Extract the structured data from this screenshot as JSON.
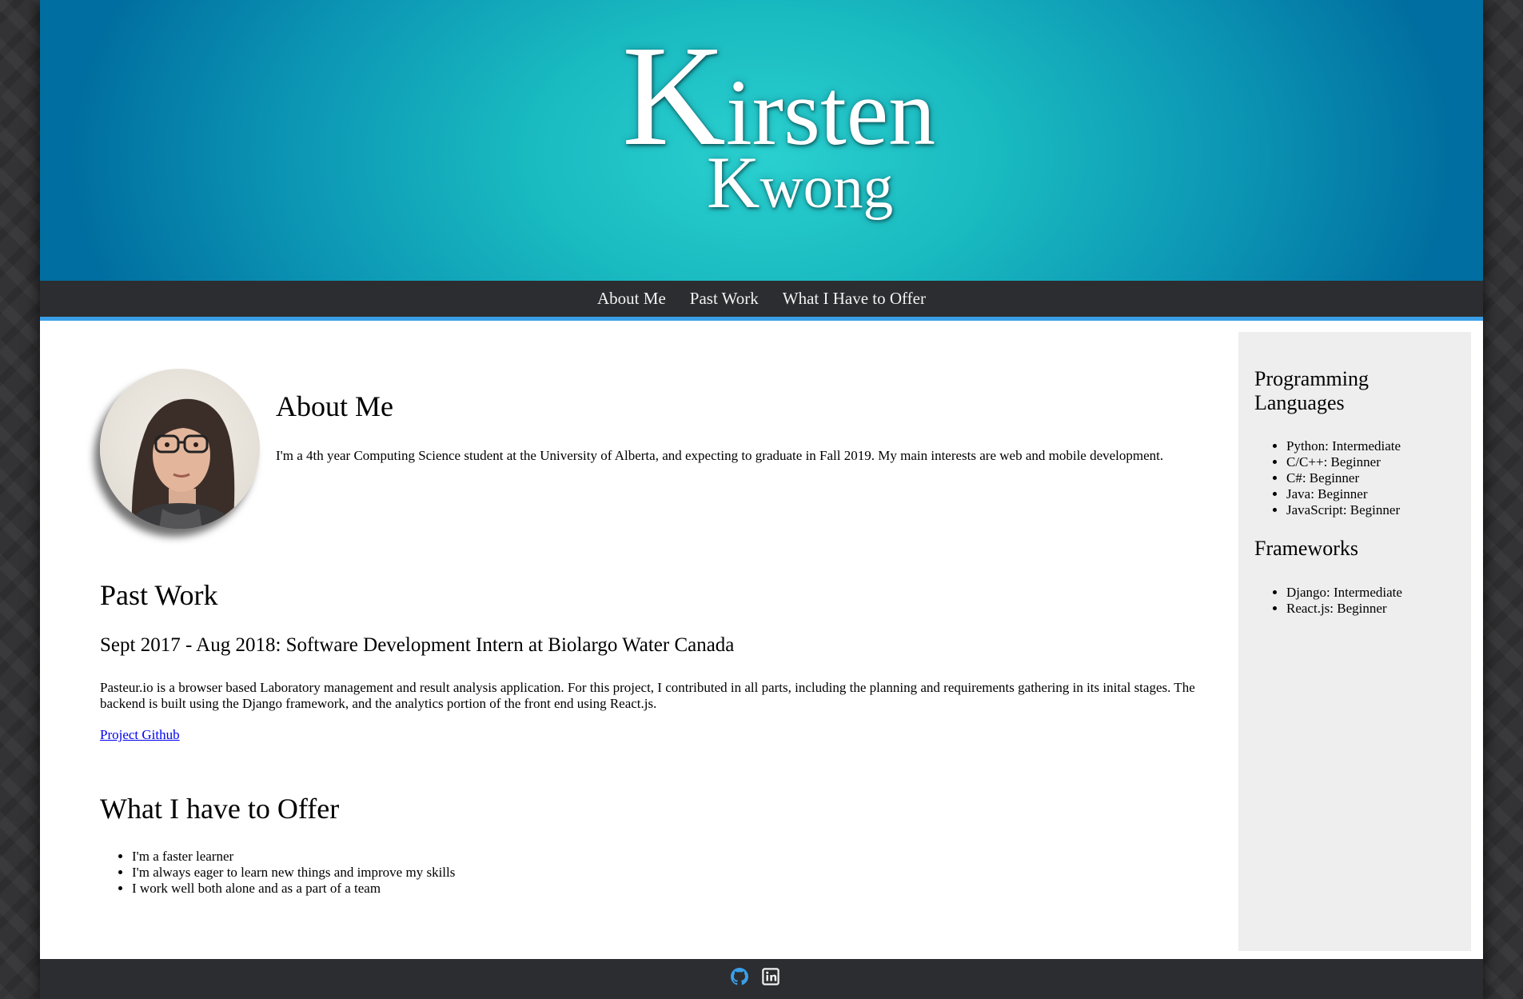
{
  "banner": {
    "first_initial": "K",
    "first_rest": "irsten",
    "last_initial": "K",
    "last_rest": "wong"
  },
  "nav": {
    "items": [
      {
        "label": "About Me"
      },
      {
        "label": "Past Work"
      },
      {
        "label": "What I Have to Offer"
      }
    ]
  },
  "about": {
    "title": "About Me",
    "text": "I'm a 4th year Computing Science student at the University of Alberta, and expecting to graduate in Fall 2019. My main interests are web and mobile development."
  },
  "past_work": {
    "title": "Past Work",
    "job_title": "Sept 2017 - Aug 2018: Software Development Intern at Biolargo Water Canada",
    "description": "Pasteur.io is a browser based Laboratory management and result analysis application. For this project, I contributed in all parts, including the planning and requirements gathering in its inital stages. The backend is built using the Django framework, and the analytics portion of the front end using React.js.",
    "link_label": "Project Github"
  },
  "offer": {
    "title": "What I have to Offer",
    "items": [
      "I'm a faster learner",
      "I'm always eager to learn new things and improve my skills",
      "I work well both alone and as a part of a team"
    ]
  },
  "sidebar": {
    "languages_title": "Programming Languages",
    "languages": [
      "Python: Intermediate",
      "C/C++: Beginner",
      "C#: Beginner",
      "Java: Beginner",
      "JavaScript: Beginner"
    ],
    "frameworks_title": "Frameworks",
    "frameworks": [
      "Django: Intermediate",
      "React.js: Beginner"
    ]
  },
  "footer": {
    "icons": [
      "github-icon",
      "linkedin-icon"
    ]
  },
  "colors": {
    "nav_accent": "#3a9fe8",
    "banner_center": "#2ad0cf",
    "banner_edge": "#006ea0",
    "footer_github": "#3a9fe8"
  }
}
